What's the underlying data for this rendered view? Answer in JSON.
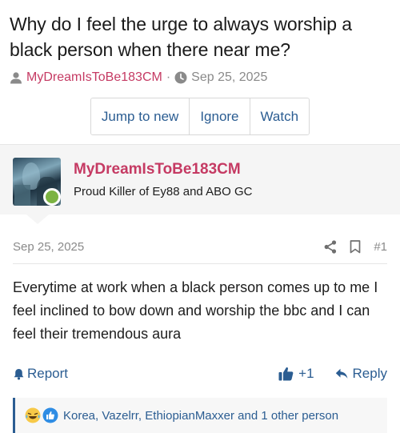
{
  "thread": {
    "title": "Why do I feel the urge to always worship a black person when there near me?",
    "author": "MyDreamIsToBe183CM",
    "separator": "·",
    "date": "Sep 25, 2025",
    "actions": [
      {
        "label": "Jump to new"
      },
      {
        "label": "Ignore"
      },
      {
        "label": "Watch"
      }
    ]
  },
  "post": {
    "user": {
      "name": "MyDreamIsToBe183CM",
      "title": "Proud Killer of Ey88 and ABO GC",
      "online": true
    },
    "date": "Sep 25, 2025",
    "number": "#1",
    "message": "Everytime at work when a black person comes up to me I feel inclined to bow down and worship the bbc and I can feel their tremendous aura",
    "footer": {
      "report_label": "Report",
      "like_label": "+1",
      "reply_label": "Reply"
    },
    "reactions": {
      "text": "Korea, Vazelrr, EthiopianMaxxer and 1 other person",
      "icons": [
        "crying-laughing-emoji-icon",
        "thumbs-up-icon"
      ]
    }
  },
  "colors": {
    "username": "#c53a63",
    "link": "#2b5d92",
    "muted": "#8a8a8a",
    "online": "#7cb342"
  }
}
